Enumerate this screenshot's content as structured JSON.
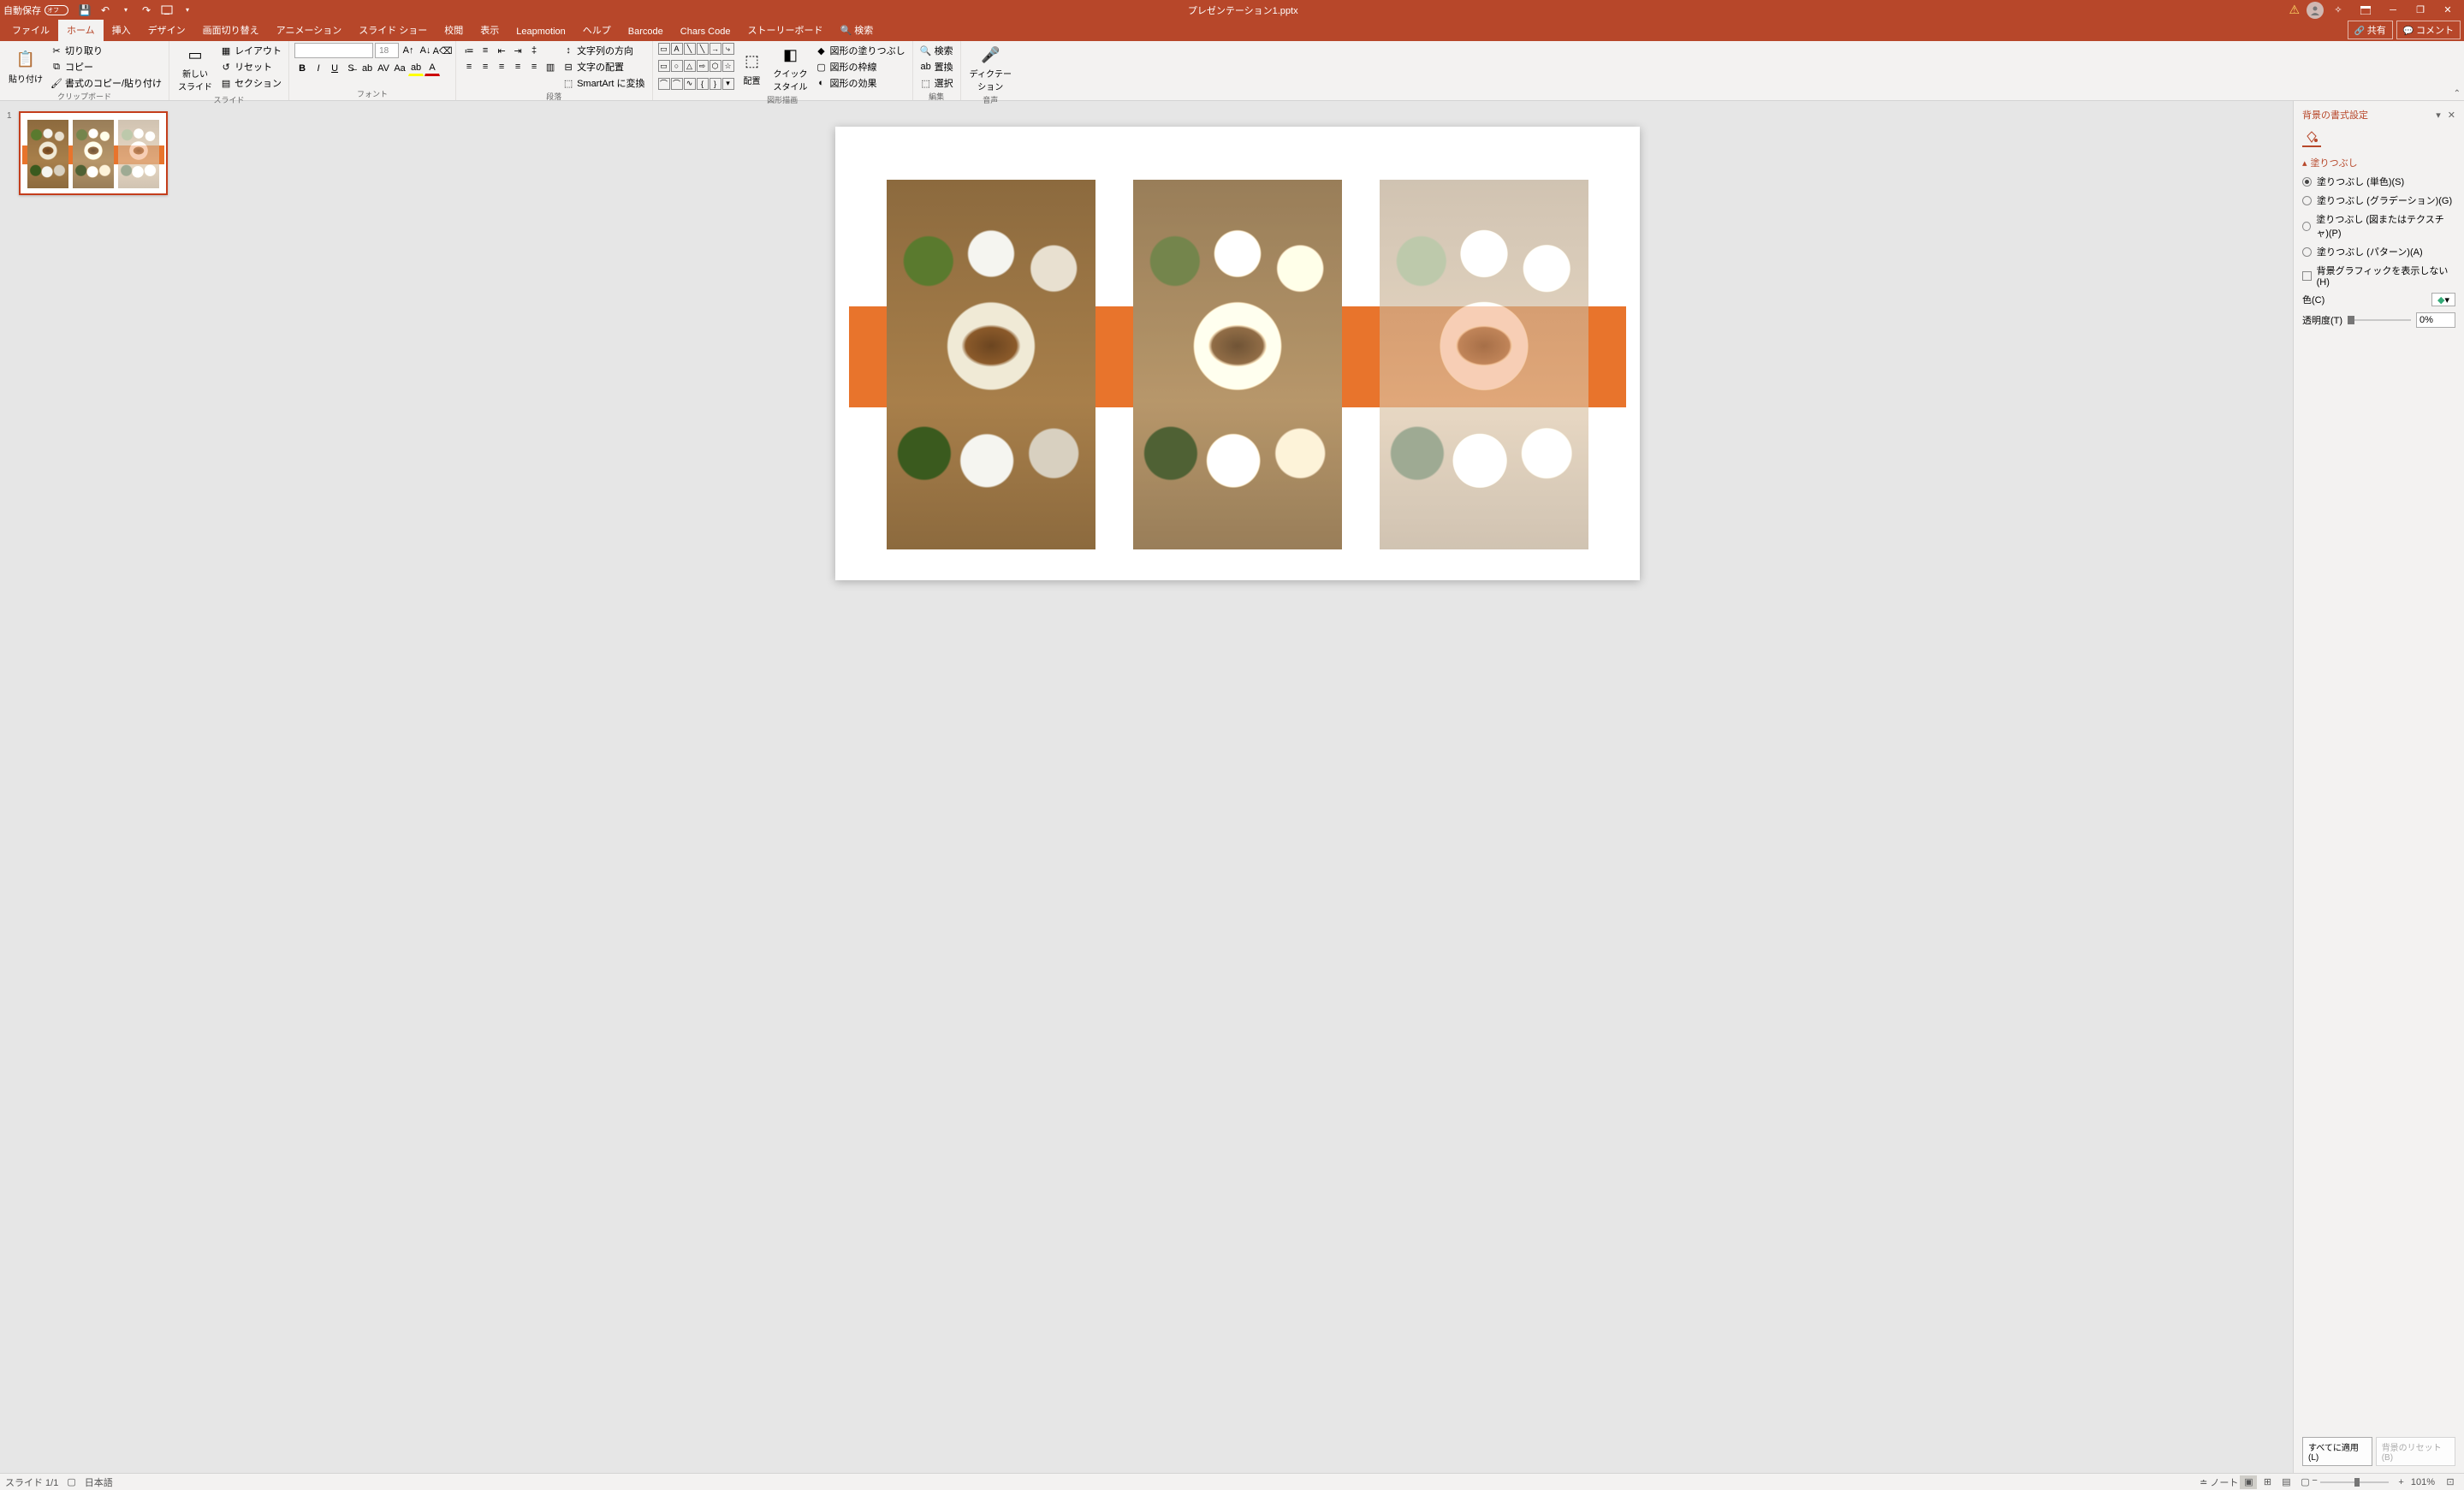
{
  "titlebar": {
    "autosave_label": "自動保存",
    "autosave_state": "オフ",
    "title": "プレゼンテーション1.pptx",
    "qat": {
      "save": "💾",
      "undo": "↶",
      "redo": "↷",
      "start": "▢",
      "more": "▾"
    }
  },
  "tabs": {
    "file": "ファイル",
    "home": "ホーム",
    "insert": "挿入",
    "design": "デザイン",
    "transitions": "画面切り替え",
    "animations": "アニメーション",
    "slideshow": "スライド ショー",
    "review": "校閲",
    "view": "表示",
    "leapmotion": "Leapmotion",
    "help": "ヘルプ",
    "barcode": "Barcode",
    "charscode": "Chars Code",
    "storyboard": "ストーリーボード",
    "search": "検索",
    "share": "共有",
    "comments": "コメント"
  },
  "ribbon": {
    "clipboard": {
      "paste": "貼り付け",
      "cut": "切り取り",
      "copy": "コピー",
      "format_painter": "書式のコピー/貼り付け",
      "label": "クリップボード"
    },
    "slides": {
      "new_slide": "新しい\nスライド",
      "layout": "レイアウト",
      "reset": "リセット",
      "section": "セクション",
      "label": "スライド"
    },
    "font": {
      "font_name": "",
      "font_size": "18",
      "label": "フォント"
    },
    "paragraph": {
      "text_direction": "文字列の方向",
      "align_text": "文字の配置",
      "smartart": "SmartArt に変換",
      "label": "段落"
    },
    "drawing": {
      "arrange": "配置",
      "quick_styles": "クイック\nスタイル",
      "shape_fill": "図形の塗りつぶし",
      "shape_outline": "図形の枠線",
      "shape_effects": "図形の効果",
      "label": "図形描画"
    },
    "editing": {
      "find": "検索",
      "replace": "置換",
      "select": "選択",
      "label": "編集"
    },
    "voice": {
      "dictate": "ディクテー\nション",
      "label": "音声"
    }
  },
  "thumbnails": {
    "slide1_num": "1"
  },
  "pane": {
    "title": "背景の書式設定",
    "section": "塗りつぶし",
    "solid": "塗りつぶし (単色)(S)",
    "gradient": "塗りつぶし (グラデーション)(G)",
    "picture": "塗りつぶし (図またはテクスチャ)(P)",
    "pattern": "塗りつぶし (パターン)(A)",
    "hide_bg": "背景グラフィックを表示しない(H)",
    "color": "色(C)",
    "transparency": "透明度(T)",
    "transparency_val": "0%",
    "apply_all": "すべてに適用(L)",
    "reset_bg": "背景のリセット(B)"
  },
  "statusbar": {
    "slide": "スライド 1/1",
    "lang": "日本語",
    "notes": "ノート",
    "zoom": "101%"
  }
}
